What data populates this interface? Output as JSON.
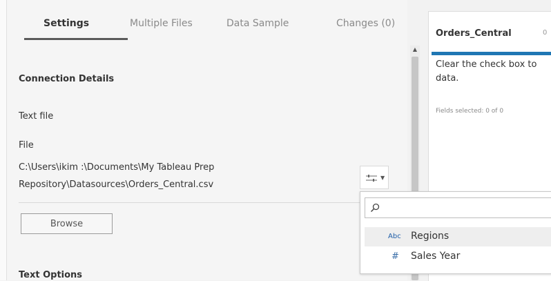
{
  "tabs": [
    "Settings",
    "Multiple Files",
    "Data Sample",
    "Changes (0)"
  ],
  "connection": {
    "title": "Connection Details",
    "type_label": "Text file",
    "file_label": "File",
    "path_line1": "C:\\Users\\ikim :\\Documents\\My Tableau Prep",
    "path_line2": "Repository\\Datasources\\Orders_Central.csv",
    "browse_label": "Browse"
  },
  "text_options": {
    "title": "Text Options"
  },
  "right_panel": {
    "title": "Orders_Central",
    "count": "0",
    "description_line1": "Clear the check box to",
    "description_line2": "data.",
    "fields_selected": "Fields selected: 0 of 0"
  },
  "filter_menu": {
    "search_placeholder": "",
    "items": [
      {
        "type_icon": "Abc",
        "name": "Regions"
      },
      {
        "type_icon": "#",
        "name": "Sales Year"
      }
    ]
  },
  "colors": {
    "accent": "#1f77b4",
    "type_icon": "#1f5ea8"
  },
  "icons": [
    "filter-sliders-icon",
    "chevron-down-icon",
    "search-icon",
    "scroll-up-icon",
    "string-type-icon",
    "number-type-icon"
  ]
}
